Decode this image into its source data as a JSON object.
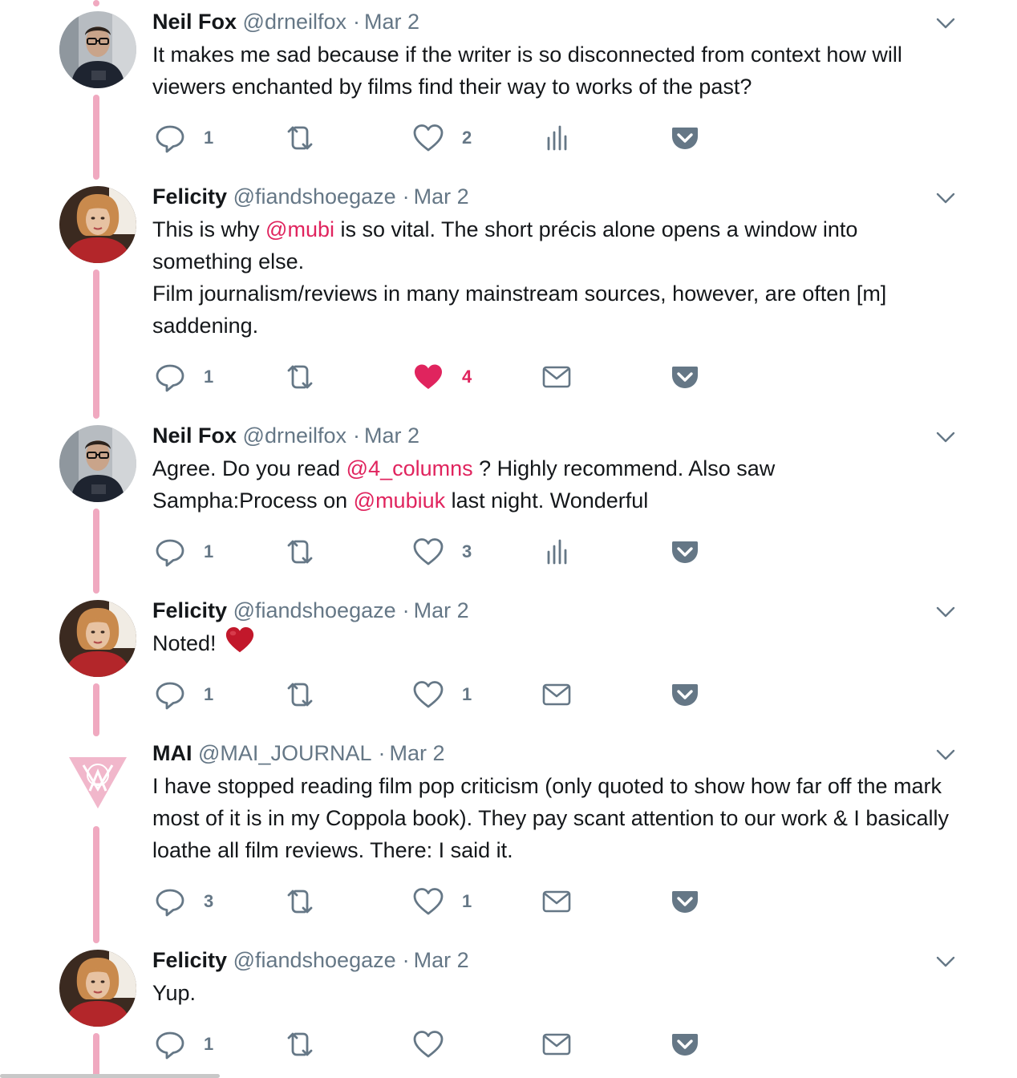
{
  "colors": {
    "thread_line": "#f0a9c0",
    "mention": "#e0245e",
    "liked_heart": "#e0245e",
    "muted_text": "#657786",
    "icon": "#657786"
  },
  "tweets": [
    {
      "name": "Neil Fox",
      "handle": "@drneilfox",
      "separator": "·",
      "date": "Mar 2",
      "avatar_icon": "avatar-photo-man-glasses",
      "body": [
        "It makes me sad because if the writer is so disconnected from context how will viewers enchanted by films find their way to works of the past?"
      ],
      "reply_count": "1",
      "like_count": "2",
      "extra_icon": "analytics-icon"
    },
    {
      "name": "Felicity",
      "handle": "@fiandshoegaze",
      "separator": "·",
      "date": "Mar 2",
      "avatar_icon": "avatar-photo-woman-red",
      "body_mention": "@mubi",
      "body_before": "This is why",
      "body_after": "is so vital. The short précis alone opens a window into something else.",
      "body_line2": "Film journalism/reviews in many mainstream sources, however, are often [m] saddening.",
      "reply_count": "1",
      "like_count": "4",
      "liked": true,
      "extra_icon": "envelope-icon"
    },
    {
      "name": "Neil Fox",
      "handle": "@drneilfox",
      "separator": "·",
      "date": "Mar 2",
      "avatar_icon": "avatar-photo-man-glasses",
      "seg1": "Agree. Do you read",
      "mention1": "@4_columns",
      "seg2": "? Highly recommend. Also saw Sampha:Process on",
      "mention2": "@mubiuk",
      "seg3": "last night. Wonderful",
      "reply_count": "1",
      "like_count": "3",
      "extra_icon": "analytics-icon"
    },
    {
      "name": "Felicity",
      "handle": "@fiandshoegaze",
      "separator": "·",
      "date": "Mar 2",
      "avatar_icon": "avatar-photo-woman-red",
      "body": "Noted!",
      "emoji": "heart-emoji-icon",
      "reply_count": "1",
      "like_count": "1",
      "extra_icon": "envelope-icon"
    },
    {
      "name": "MAI",
      "handle": "@MAI_JOURNAL",
      "separator": "·",
      "date": "Mar 2",
      "avatar_icon": "mai-triangle-logo",
      "body": "I have stopped reading film pop criticism (only quoted to show how far off the mark most of it is in my Coppola book). They pay scant attention to our work & I basically loathe all film reviews. There: I said it.",
      "reply_count": "3",
      "like_count": "1",
      "extra_icon": "envelope-icon"
    },
    {
      "name": "Felicity",
      "handle": "@fiandshoegaze",
      "separator": "·",
      "date": "Mar 2",
      "avatar_icon": "avatar-photo-woman-red",
      "body": "Yup.",
      "reply_count": "1",
      "like_count": "",
      "extra_icon": "envelope-icon"
    }
  ]
}
